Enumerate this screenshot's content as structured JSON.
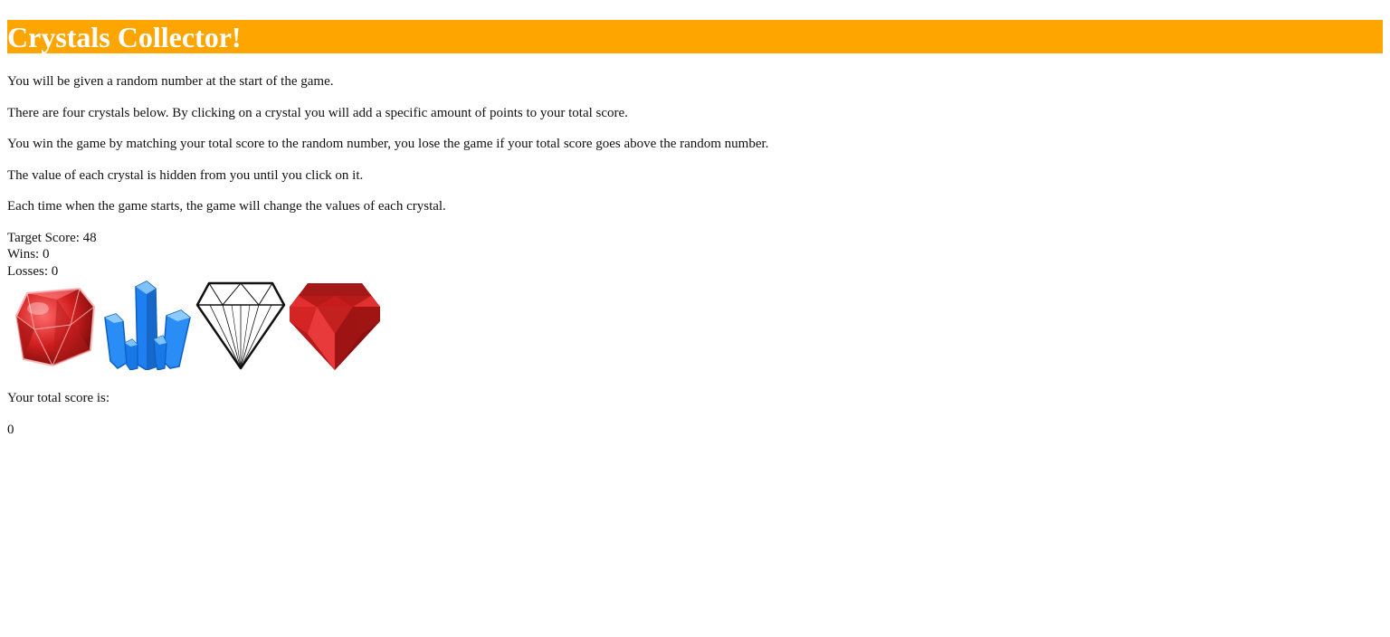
{
  "header": {
    "title": "Crystals Collector!",
    "background_color": "#ffa500"
  },
  "instructions": [
    "You will be given a random number at the start of the game.",
    "There are four crystals below. By clicking on a crystal you will add a specific amount of points to your total score.",
    "You win the game by matching your total score to the random number, you lose the game if your total score goes above the random number.",
    "The value of each crystal is hidden from you until you click on it.",
    "Each time when the game starts, the game will change the values of each crystal."
  ],
  "stats": {
    "target": "Target Score: 48",
    "wins": "Wins: 0",
    "losses": "Losses: 0"
  },
  "crystals": [
    {
      "icon": "ruby-gem-icon",
      "color": "#d21f1f"
    },
    {
      "icon": "blue-crystal-cluster-icon",
      "color": "#1e7ff0"
    },
    {
      "icon": "diamond-outline-icon",
      "color": "#111111"
    },
    {
      "icon": "red-gem-icon",
      "color": "#c81c1c"
    }
  ],
  "score": {
    "label": "Your total score is:",
    "value": "0"
  }
}
